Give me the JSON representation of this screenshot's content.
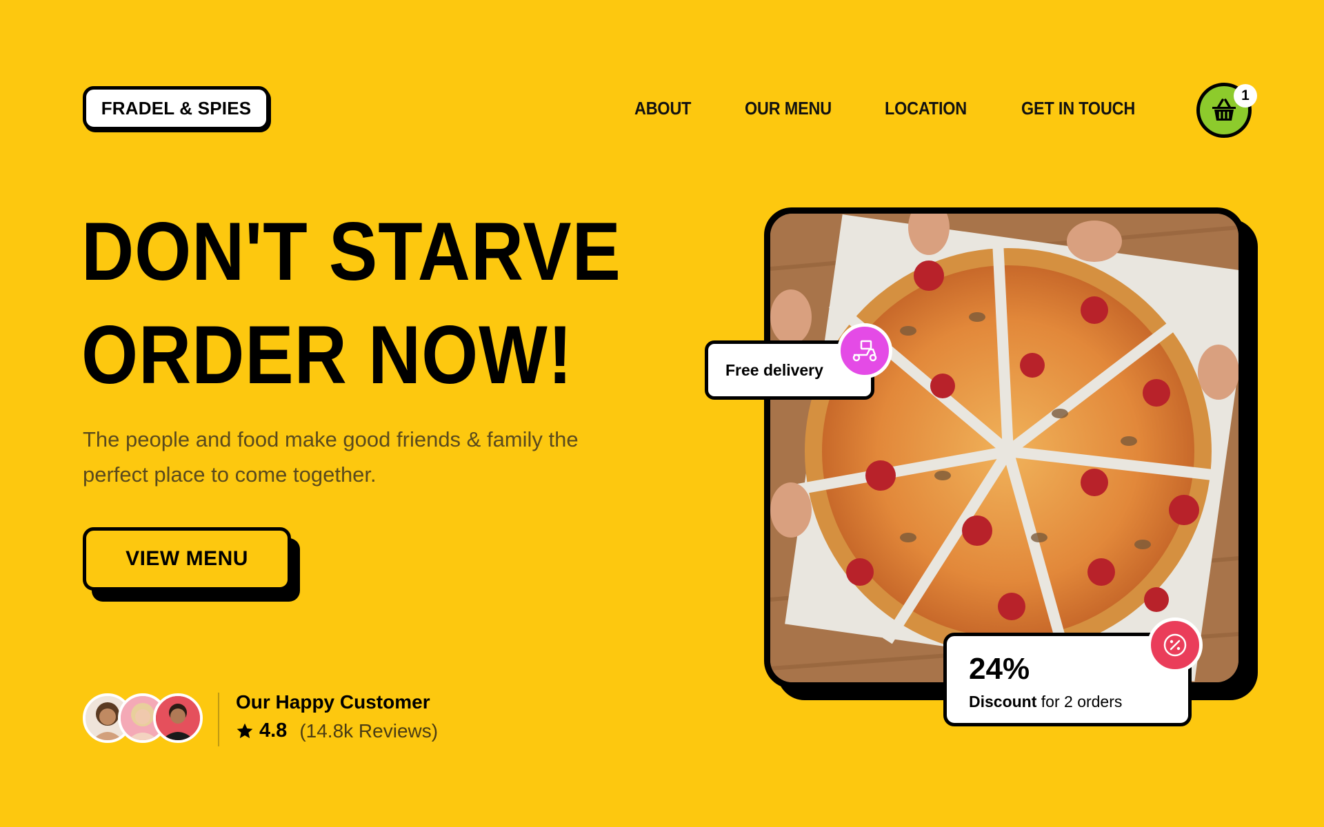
{
  "brand": {
    "logo_text": "FRADEL & SPIES"
  },
  "nav": {
    "items": [
      {
        "label": "ABOUT"
      },
      {
        "label": "OUR MENU"
      },
      {
        "label": "LOCATION"
      },
      {
        "label": "GET IN TOUCH"
      }
    ]
  },
  "cart": {
    "icon": "basket-icon",
    "count": "1"
  },
  "hero": {
    "title_line1": "DON'T STARVE",
    "title_line2": "ORDER NOW!",
    "description": "The people and food make good friends & family the perfect place to come together.",
    "cta_label": "VIEW MENU"
  },
  "customers": {
    "title": "Our Happy Customer",
    "rating": "4.8",
    "reviews": "(14.8k Reviews)"
  },
  "badges": {
    "delivery_label": "Free delivery",
    "delivery_icon": "scooter-icon",
    "discount_value": "24%",
    "discount_bold": "Discount",
    "discount_rest": " for 2 orders",
    "discount_icon": "percent-icon"
  },
  "colors": {
    "background": "#FDC80F",
    "cart": "#8DCB2C",
    "delivery_icon": "#E44BE6",
    "discount_icon": "#EA3D5A"
  }
}
